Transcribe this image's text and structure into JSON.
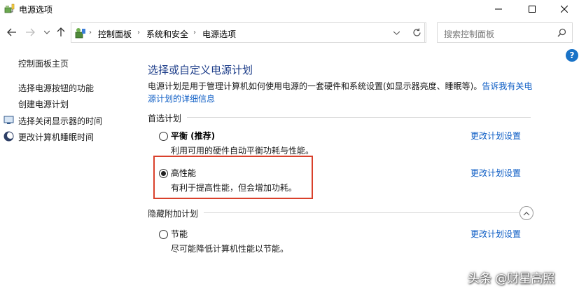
{
  "window": {
    "title": "电源选项"
  },
  "address": {
    "crumbs": [
      "控制面板",
      "系统和安全",
      "电源选项"
    ],
    "search_placeholder": "搜索控制面板"
  },
  "sidebar": {
    "home": "控制面板主页",
    "items": [
      {
        "label": "选择电源按钮的功能",
        "icon": "none"
      },
      {
        "label": "创建电源计划",
        "icon": "none"
      },
      {
        "label": "选择关闭显示器的时间",
        "icon": "monitor-icon"
      },
      {
        "label": "更改计算机睡眠时间",
        "icon": "moon-icon"
      }
    ]
  },
  "main": {
    "title": "选择或自定义电源计划",
    "description": "电源计划是用于管理计算机如何使用电源的一套硬件和系统设置(如显示器亮度、睡眠等)。",
    "description_link": "告诉我有关电源计划的详细信息",
    "preferred_label": "首选计划",
    "hidden_label": "隐藏附加计划",
    "plans": [
      {
        "name": "平衡 (推荐)",
        "desc": "利用可用的硬件自动平衡功耗与性能。",
        "link": "更改计划设置",
        "selected": false
      },
      {
        "name": "高性能",
        "desc": "有利于提高性能，但会增加功耗。",
        "link": "更改计划设置",
        "selected": true
      },
      {
        "name": "节能",
        "desc": "尽可能降低计算机性能以节能。",
        "link": "更改计划设置",
        "selected": false
      }
    ]
  },
  "watermark": "头条 @财星高照",
  "colors": {
    "link": "#0a5bc4",
    "title": "#1e3e8a",
    "highlight": "#d9402b",
    "help": "#1a73c7"
  }
}
